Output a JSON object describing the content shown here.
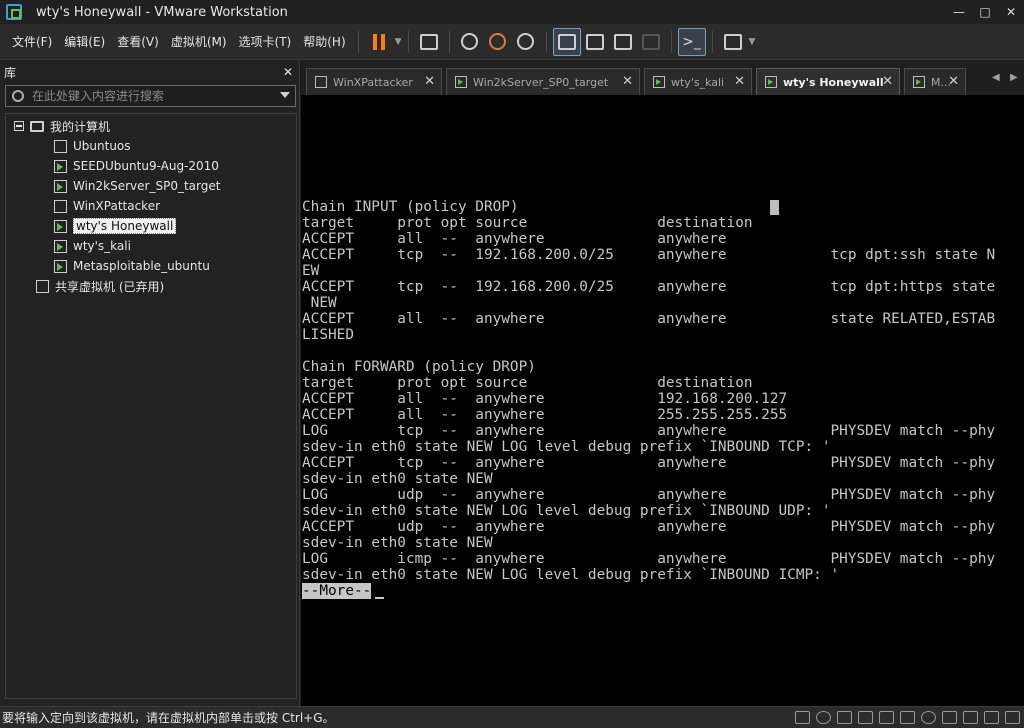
{
  "window": {
    "title": "wty's Honeywall - VMware Workstation"
  },
  "menu": {
    "items": [
      {
        "label": "文件(F)"
      },
      {
        "label": "编辑(E)"
      },
      {
        "label": "查看(V)"
      },
      {
        "label": "虚拟机(M)"
      },
      {
        "label": "选项卡(T)"
      },
      {
        "label": "帮助(H)"
      }
    ]
  },
  "toolbar": {
    "icons": [
      "pause-icon",
      "send-ctrl-alt-del-icon",
      "snapshot-icon",
      "revert-snapshot-icon",
      "snapshot-manager-icon",
      "show-library-icon",
      "thumbnail-bar-icon",
      "full-screen-icon",
      "unity-icon",
      "console-view-icon",
      "stretch-icon"
    ],
    "accent": "#ff7a1a"
  },
  "library": {
    "title": "库",
    "search_placeholder": "在此处键入内容进行搜索",
    "root_label": "我的计算机",
    "vms": [
      {
        "label": "Ubuntuos",
        "running": false
      },
      {
        "label": "SEEDUbuntu9-Aug-2010",
        "running": true
      },
      {
        "label": "Win2kServer_SP0_target",
        "running": true
      },
      {
        "label": "WinXPattacker",
        "running": false
      },
      {
        "label": "wty's Honeywall",
        "running": true,
        "selected": true
      },
      {
        "label": "wty's_kali",
        "running": true
      },
      {
        "label": "Metasploitable_ubuntu",
        "running": true
      }
    ],
    "shared_label": "共享虚拟机 (已弃用)"
  },
  "tabs": [
    {
      "label": "WinXPattacker",
      "running": false,
      "active": false
    },
    {
      "label": "Win2kServer_SP0_target",
      "running": true,
      "active": false
    },
    {
      "label": "wty's_kali",
      "running": true,
      "active": false
    },
    {
      "label": "wty's Honeywall",
      "running": true,
      "active": true
    },
    {
      "label": "M...",
      "running": true,
      "active": false
    }
  ],
  "console": {
    "lines": [
      "Chain INPUT (policy DROP)",
      "target     prot opt source               destination",
      "ACCEPT     all  --  anywhere             anywhere",
      "ACCEPT     tcp  --  192.168.200.0/25     anywhere            tcp dpt:ssh state N",
      "EW",
      "ACCEPT     tcp  --  192.168.200.0/25     anywhere            tcp dpt:https state",
      " NEW",
      "ACCEPT     all  --  anywhere             anywhere            state RELATED,ESTAB",
      "LISHED",
      "",
      "Chain FORWARD (policy DROP)",
      "target     prot opt source               destination",
      "ACCEPT     all  --  anywhere             192.168.200.127",
      "ACCEPT     all  --  anywhere             255.255.255.255",
      "LOG        tcp  --  anywhere             anywhere            PHYSDEV match --phy",
      "sdev-in eth0 state NEW LOG level debug prefix `INBOUND TCP: '",
      "ACCEPT     tcp  --  anywhere             anywhere            PHYSDEV match --phy",
      "sdev-in eth0 state NEW",
      "LOG        udp  --  anywhere             anywhere            PHYSDEV match --phy",
      "sdev-in eth0 state NEW LOG level debug prefix `INBOUND UDP: '",
      "ACCEPT     udp  --  anywhere             anywhere            PHYSDEV match --phy",
      "sdev-in eth0 state NEW",
      "LOG        icmp --  anywhere             anywhere            PHYSDEV match --phy",
      "sdev-in eth0 state NEW LOG level debug prefix `INBOUND ICMP: '"
    ],
    "more_prompt": "--More--"
  },
  "statusbar": {
    "message": "要将输入定向到该虚拟机，请在虚拟机内部单击或按 Ctrl+G。"
  }
}
